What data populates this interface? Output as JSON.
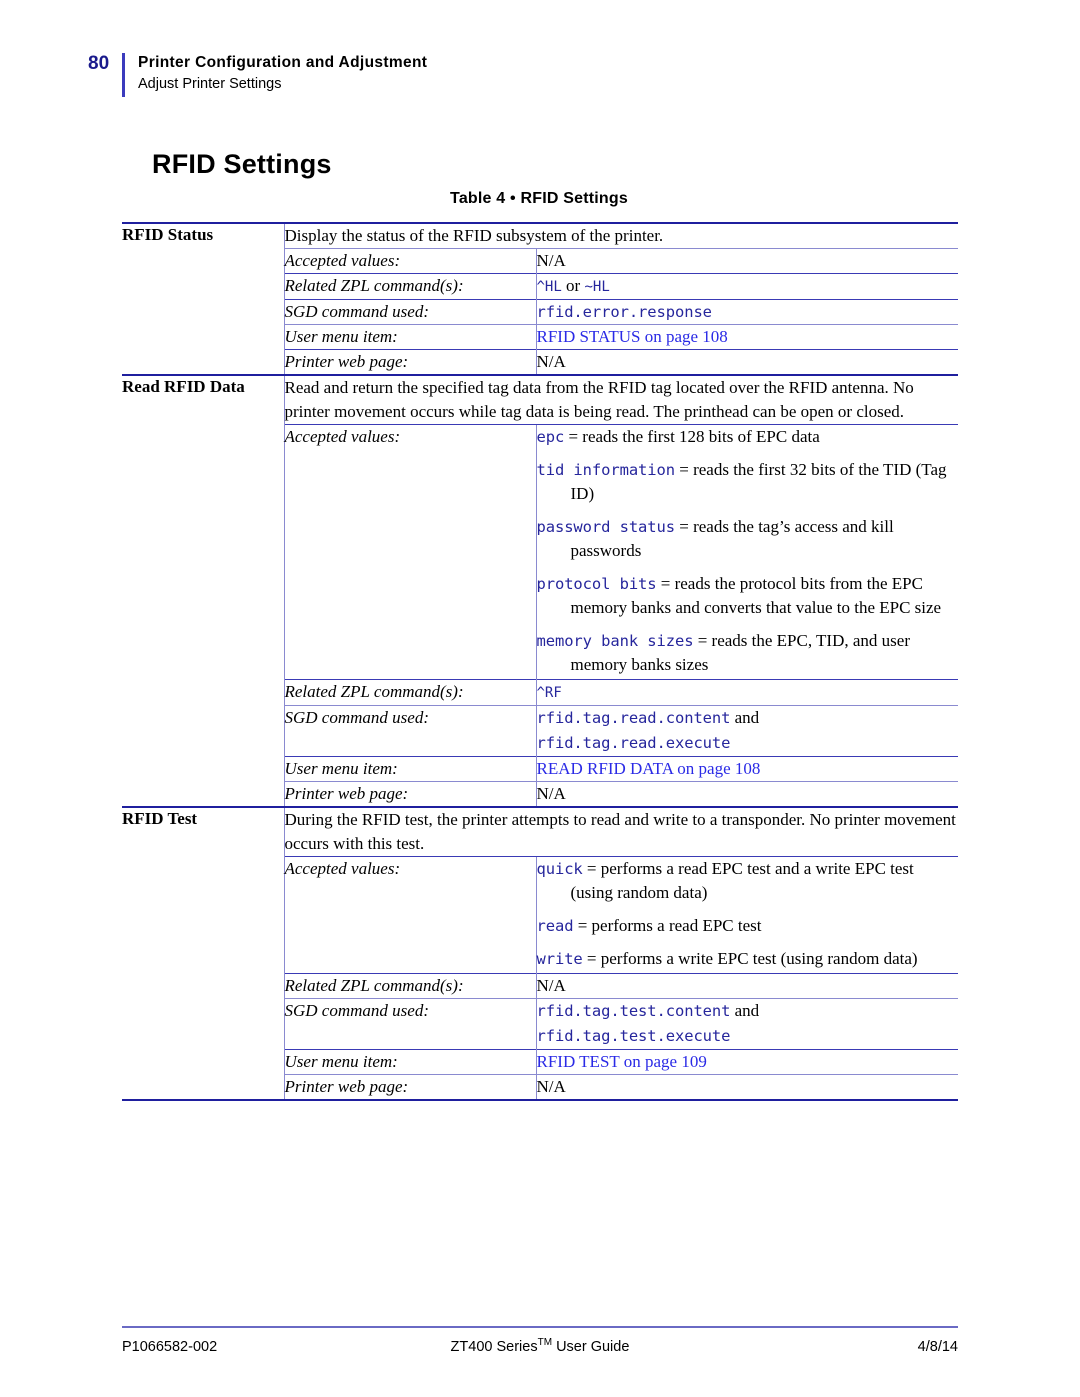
{
  "header": {
    "page_number": "80",
    "title": "Printer Configuration and Adjustment",
    "subtitle": "Adjust Printer Settings"
  },
  "section_heading": "RFID Settings",
  "table": {
    "caption": "Table 4 • RFID Settings",
    "field_labels": {
      "accepted_values": "Accepted values:",
      "related_zpl": "Related ZPL command(s):",
      "sgd_command": "SGD command used:",
      "user_menu": "User menu item:",
      "printer_web": "Printer web page:"
    },
    "sections": [
      {
        "name": "RFID Status",
        "description": "Display the status of the RFID subsystem of the printer.",
        "accepted_values": "N/A",
        "related_zpl_code_1": "^HL",
        "related_zpl_joiner": " or ",
        "related_zpl_code_2": "~HL",
        "sgd_command": "rfid.error.response",
        "user_menu": "RFID STATUS on page 108",
        "printer_web": "N/A"
      },
      {
        "name": "Read RFID Data",
        "description": "Read and return the specified tag data from the RFID tag located over the RFID antenna. No printer movement occurs while tag data is being read. The printhead can be open or closed.",
        "accepted_values_list": [
          {
            "code": "epc",
            "text": " = reads the first 128 bits of EPC data"
          },
          {
            "code": "tid information",
            "text": " = reads the first 32 bits of the TID (Tag ID)"
          },
          {
            "code": "password status",
            "text": " = reads the tag’s access and kill passwords"
          },
          {
            "code": "protocol bits",
            "text": " = reads the protocol bits from the EPC memory banks and converts that value to the EPC size"
          },
          {
            "code": "memory bank sizes",
            "text": " = reads the EPC, TID, and user memory banks sizes"
          }
        ],
        "related_zpl_code_1": "^RF",
        "sgd_command_line_1": "rfid.tag.read.content",
        "sgd_command_joiner": " and",
        "sgd_command_line_2": "rfid.tag.read.execute",
        "user_menu": "READ RFID DATA on page 108",
        "printer_web": "N/A"
      },
      {
        "name": "RFID Test",
        "description": "During the RFID test, the printer attempts to read and write to a transponder. No printer movement occurs with this test.",
        "accepted_values_list": [
          {
            "code": "quick",
            "text": " = performs a read EPC test and a write EPC test (using random data)"
          },
          {
            "code": "read",
            "text": " = performs a read EPC test"
          },
          {
            "code": "write",
            "text": " = performs a write EPC test (using random data)"
          }
        ],
        "related_zpl": "N/A",
        "sgd_command_line_1": "rfid.tag.test.content",
        "sgd_command_joiner": " and",
        "sgd_command_line_2": "rfid.tag.test.execute",
        "user_menu": "RFID TEST on page 109",
        "printer_web": "N/A"
      }
    ]
  },
  "footer": {
    "left": "P1066582-002",
    "center_main": "ZT400 Series",
    "center_tm": "TM",
    "center_tail": " User Guide",
    "right": "4/8/14"
  },
  "colors": {
    "rule_dark": "#1f1f9e",
    "rule_light": "#8a8ad0",
    "code_blue": "#26269c",
    "link_blue": "#2a2ae6",
    "page_number_blue": "#1a1a8c"
  }
}
